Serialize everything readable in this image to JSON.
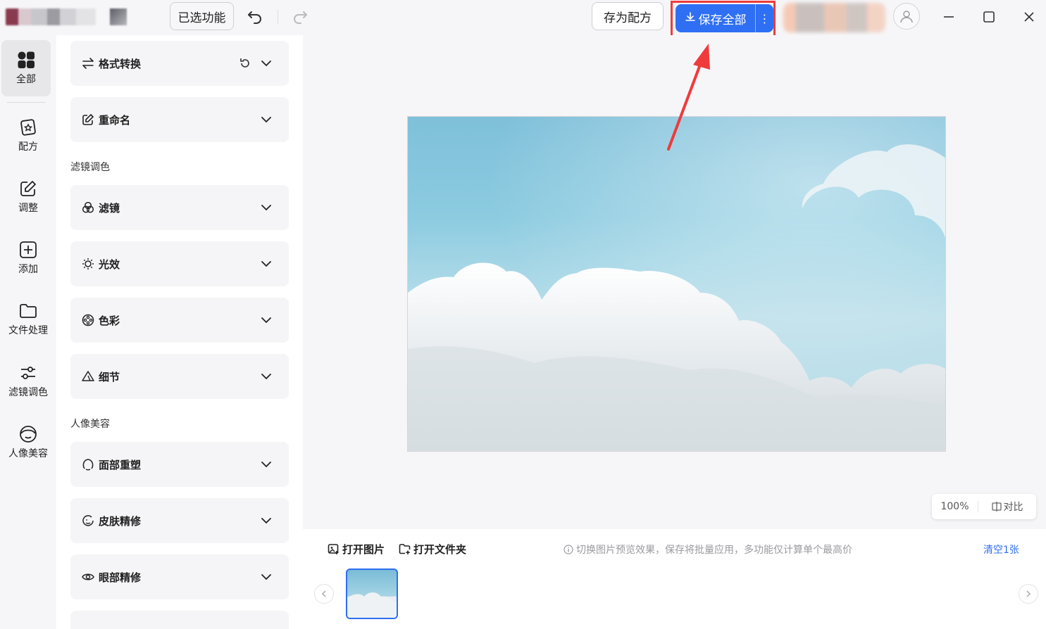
{
  "titlebar": {
    "selected_features": "已选功能",
    "save_recipe": "存为配方",
    "save_all": "保存全部"
  },
  "leftnav": {
    "items": [
      {
        "label": "全部",
        "icon": "grid-icon",
        "active": true
      },
      {
        "label": "配方",
        "icon": "recipe-icon"
      },
      {
        "label": "调整",
        "icon": "edit-icon"
      },
      {
        "label": "添加",
        "icon": "plus-square-icon"
      },
      {
        "label": "文件处理",
        "icon": "folder-icon"
      },
      {
        "label": "滤镜调色",
        "icon": "sliders-icon"
      },
      {
        "label": "人像美容",
        "icon": "face-icon"
      }
    ]
  },
  "panel": {
    "cards": [
      {
        "label": "格式转换",
        "icon": "swap-arrows-icon"
      },
      {
        "label": "重命名",
        "icon": "rename-icon"
      },
      {
        "label": "滤镜",
        "icon": "filter-circles-icon"
      },
      {
        "label": "光效",
        "icon": "sun-icon"
      },
      {
        "label": "色彩",
        "icon": "palette-icon"
      },
      {
        "label": "细节",
        "icon": "triangle-icon"
      },
      {
        "label": "面部重塑",
        "icon": "face-reshape-icon"
      },
      {
        "label": "皮肤精修",
        "icon": "skin-icon"
      },
      {
        "label": "眼部精修",
        "icon": "eye-icon"
      }
    ],
    "sections": {
      "filters": "滤镜调色",
      "portrait": "人像美容"
    }
  },
  "canvas": {
    "zoom": "100%",
    "compare": "对比"
  },
  "bottom": {
    "open_image": "打开图片",
    "open_folder": "打开文件夹",
    "hint": "切换图片预览效果，保存将批量应用，多功能仅计算单个最高价",
    "clear": "清空1张"
  },
  "colors": {
    "accent": "#2f6ff3",
    "highlight": "#ef3b3b"
  }
}
